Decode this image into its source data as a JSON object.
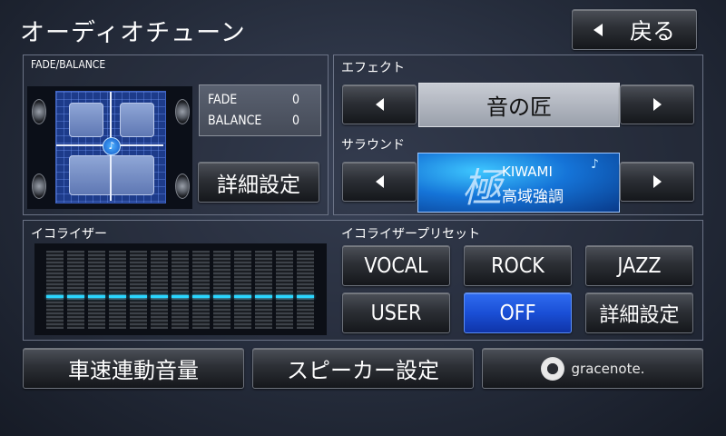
{
  "header": {
    "title": "オーディオチューン",
    "back_label": "戻る"
  },
  "fade_balance": {
    "label": "FADE/BALANCE",
    "fade_label": "FADE",
    "fade_value": "0",
    "balance_label": "BALANCE",
    "balance_value": "0",
    "detail_label": "詳細設定"
  },
  "effect": {
    "label": "エフェクト",
    "value": "音の匠"
  },
  "surround": {
    "label": "サラウンド",
    "badge_big": "極",
    "badge_top": "KIWAMI",
    "badge_bottom": "高域強調"
  },
  "equalizer": {
    "label": "イコライザー",
    "bands": 13,
    "levels": [
      0,
      0,
      0,
      0,
      0,
      0,
      0,
      0,
      0,
      0,
      0,
      0,
      0
    ]
  },
  "preset": {
    "label": "イコライザープリセット",
    "buttons": [
      "VOCAL",
      "ROCK",
      "JAZZ",
      "USER",
      "OFF",
      "詳細設定"
    ],
    "selected": "OFF"
  },
  "bottom": {
    "speed_volume": "車速連動音量",
    "speaker_setting": "スピーカー設定",
    "gracenote": "gracenote."
  },
  "colors": {
    "accent": "#1a4fd6",
    "eq_marker": "#2ad6ff"
  }
}
